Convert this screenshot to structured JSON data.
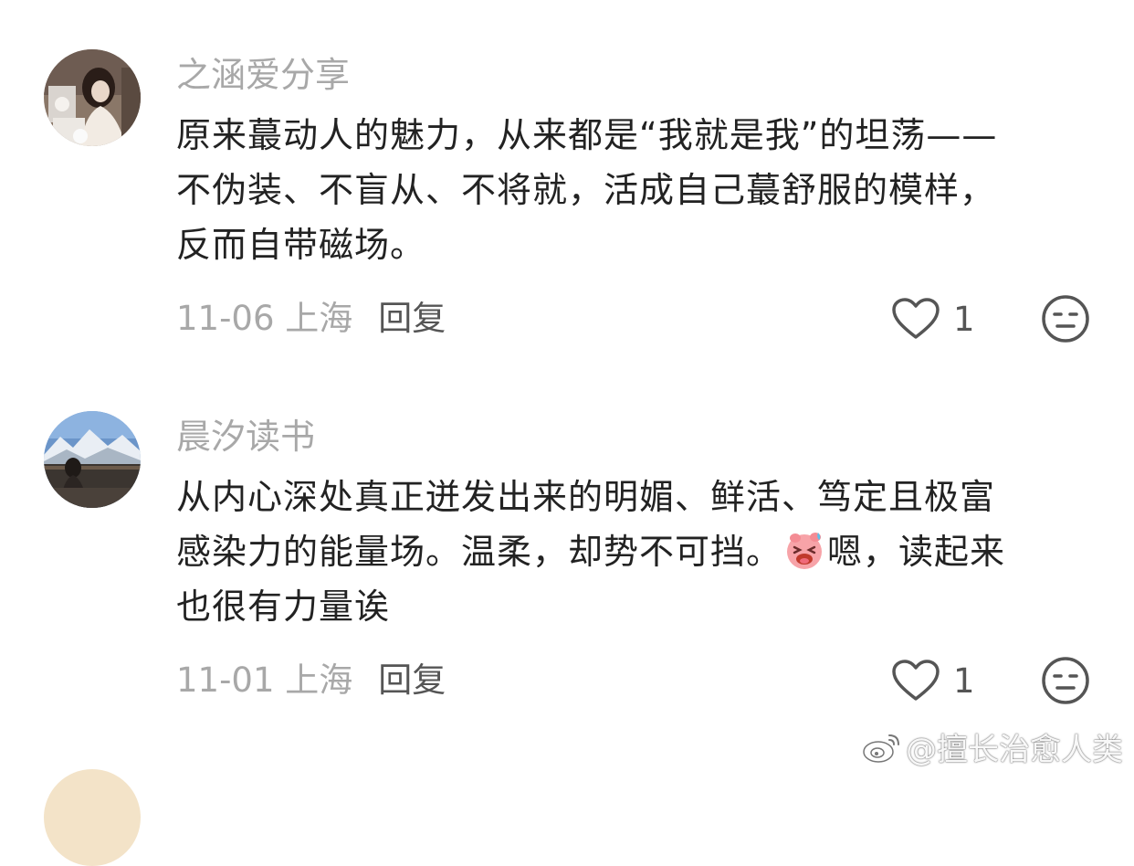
{
  "comments": [
    {
      "username": "之涵爱分享",
      "avatar_icon": "avatar-woman-hanfu",
      "lines": [
        "原来蕞动人的魅力，从来都是“我就是我”的坦荡——",
        "不伪装、不盲从、不将就，活成自己蕞舒服的模样，",
        "反而自带磁场。"
      ],
      "date_location": "11-06 上海",
      "reply_label": "回复",
      "like_count": "1"
    },
    {
      "username": "晨汐读书",
      "avatar_icon": "avatar-snow-mountain",
      "lines": [
        "从内心深处真正迸发出来的明媚、鲜活、笃定且极富",
        "感染力的能量场。温柔，却势不可挡。",
        "也很有力量诶"
      ],
      "line2_after_emoji": "嗯，读起来",
      "date_location": "11-01 上海",
      "reply_label": "回复",
      "like_count": "1"
    }
  ],
  "watermark": "@擅长治愈人类",
  "colors": {
    "secondary_text": "#a8a8a8",
    "primary_text": "#222222",
    "icon": "#555555"
  }
}
